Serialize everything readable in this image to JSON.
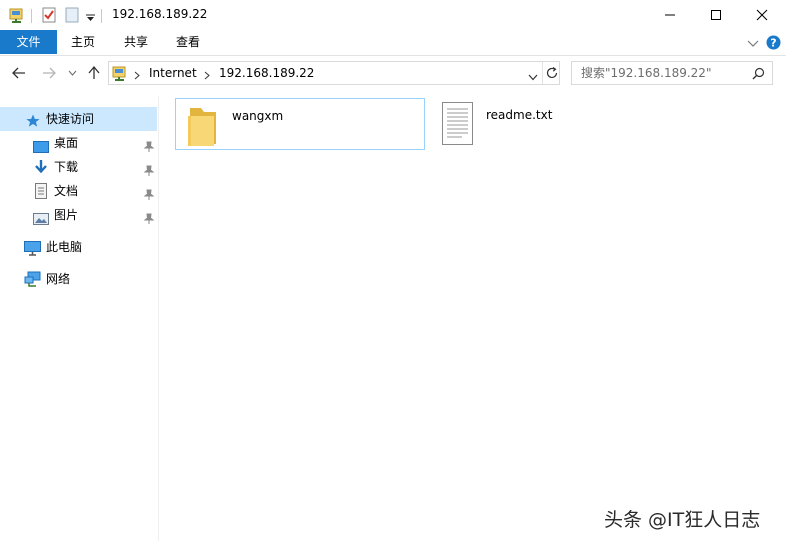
{
  "window": {
    "title": "192.168.189.22",
    "controls": {
      "minimize": "minimize",
      "maximize": "maximize",
      "close": "close"
    }
  },
  "ribbon": {
    "tabs": [
      "文件",
      "主页",
      "共享",
      "查看"
    ]
  },
  "address": {
    "breadcrumbs": [
      "Internet",
      "192.168.189.22"
    ],
    "search_placeholder": "搜索\"192.168.189.22\""
  },
  "nav": {
    "quick_access": "快速访问",
    "pinned": [
      "桌面",
      "下载",
      "文档",
      "图片"
    ],
    "this_pc": "此电脑",
    "network": "网络"
  },
  "items": [
    {
      "name": "wangxm",
      "type": "folder",
      "selected": true
    },
    {
      "name": "readme.txt",
      "type": "text-file",
      "selected": false
    }
  ],
  "watermark": "头条 @IT狂人日志",
  "colors": {
    "accent": "#1979ca",
    "selected_nav": "#cce8ff",
    "selected_border": "#99d1ff"
  }
}
